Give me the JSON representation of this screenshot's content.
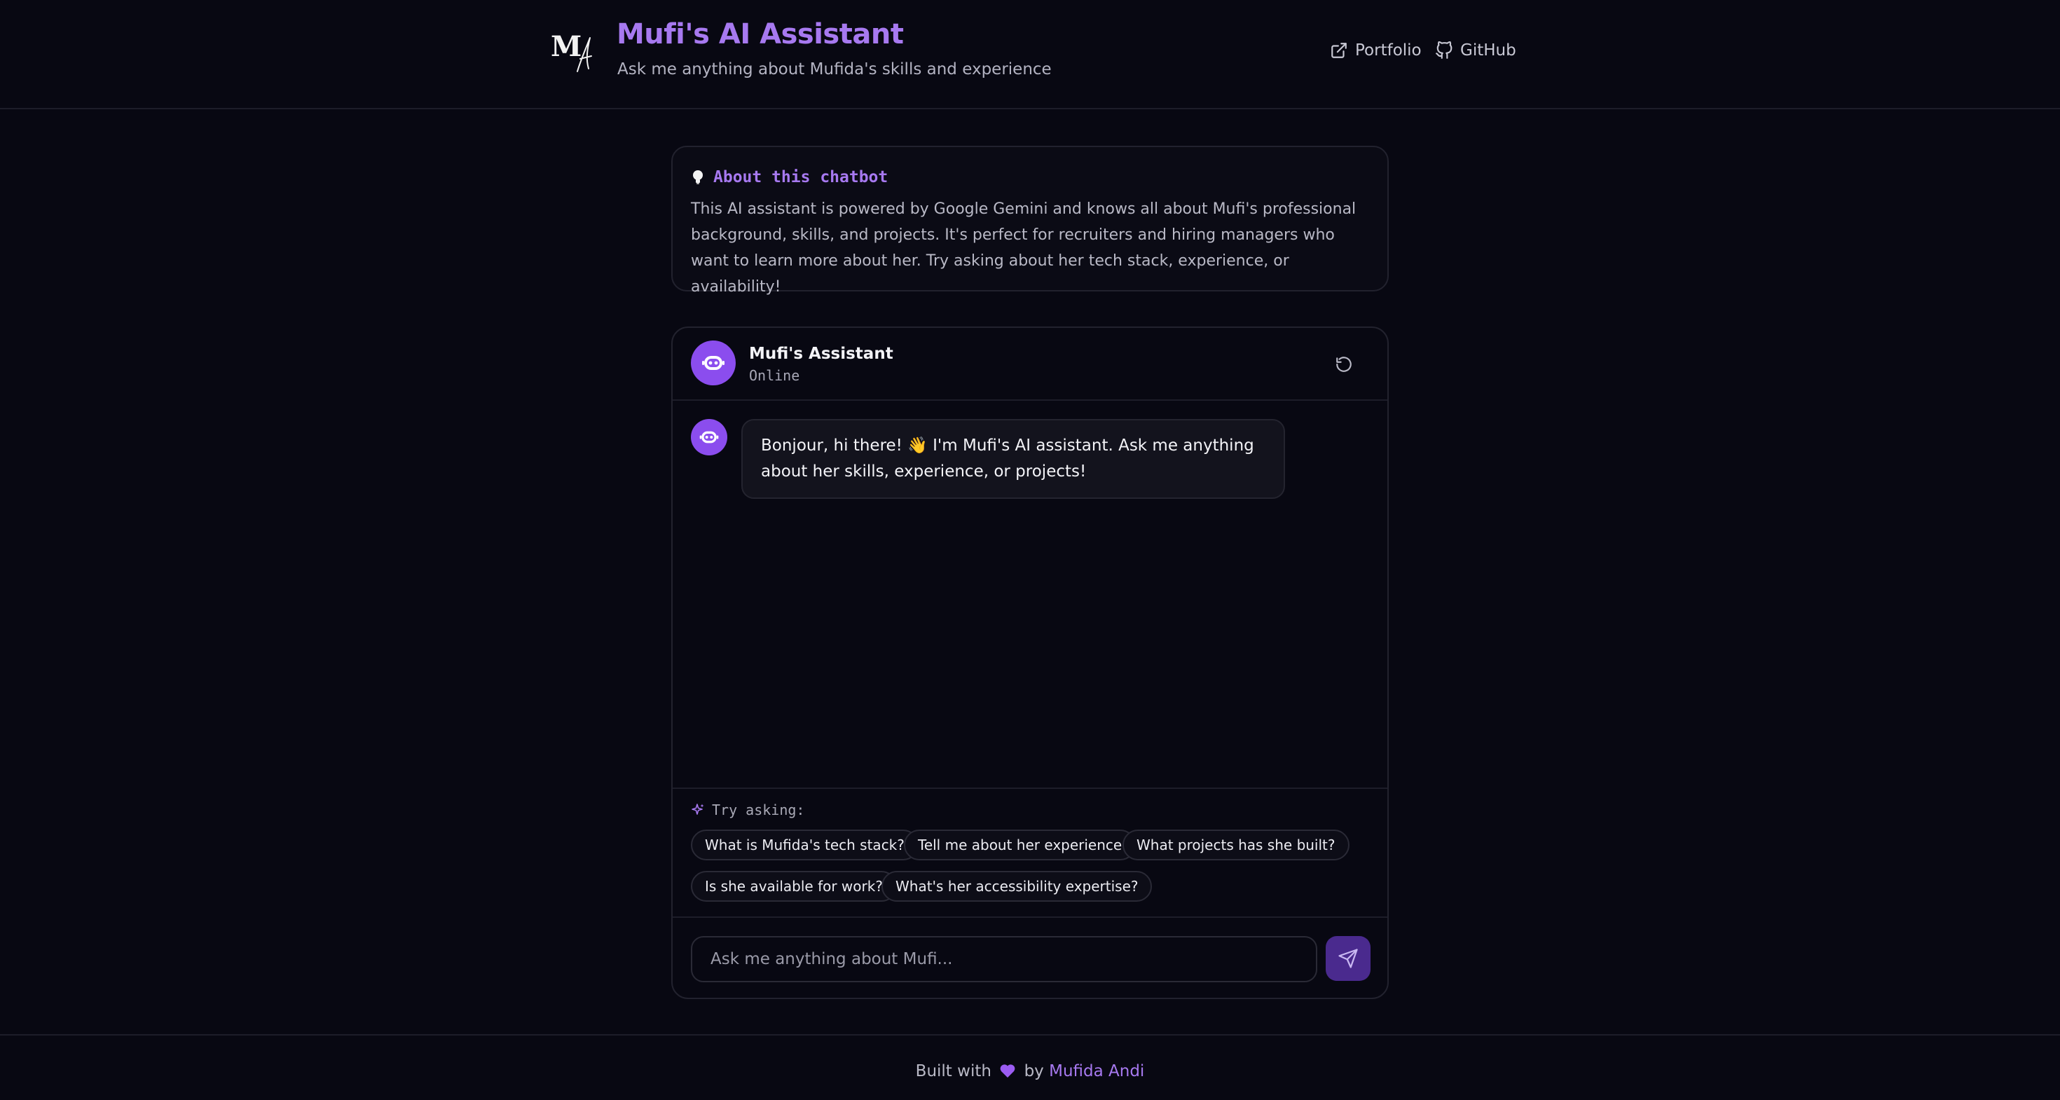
{
  "header": {
    "logo_text": "MA",
    "title": "Mufi's AI Assistant",
    "subtitle": "Ask me anything about Mufida's skills and experience",
    "nav": [
      {
        "label": "Portfolio",
        "icon": "external-link-icon"
      },
      {
        "label": "GitHub",
        "icon": "github-icon"
      }
    ]
  },
  "about": {
    "icon": "lightbulb-icon",
    "title": "About this chatbot",
    "text": "This AI assistant is powered by Google Gemini and knows all about Mufi's professional background, skills, and projects. It's perfect for recruiters and hiring managers who want to learn more about her. Try asking about her tech stack, experience, or availability!"
  },
  "chat": {
    "assistant_name": "Mufi's Assistant",
    "status": "Online",
    "reset_icon": "refresh-icon",
    "messages": [
      {
        "role": "assistant",
        "text": "Bonjour, hi there! 👋 I'm Mufi's AI assistant. Ask me anything about her skills, experience, or projects!"
      }
    ],
    "suggestions_label": "Try asking:",
    "suggestions": [
      "What is Mufida's tech stack?",
      "Tell me about her experience",
      "What projects has she built?",
      "Is she available for work?",
      "What's her accessibility expertise?"
    ],
    "input_placeholder": "Ask me anything about Mufi...",
    "send_icon": "send-icon"
  },
  "footer": {
    "prefix": "Built with",
    "suffix": "by",
    "link": "Mufida Andi"
  },
  "colors": {
    "background": "#080812",
    "accent": "#a779f0",
    "avatar": "#8b4dee",
    "send_button": "#4a2a8e"
  }
}
